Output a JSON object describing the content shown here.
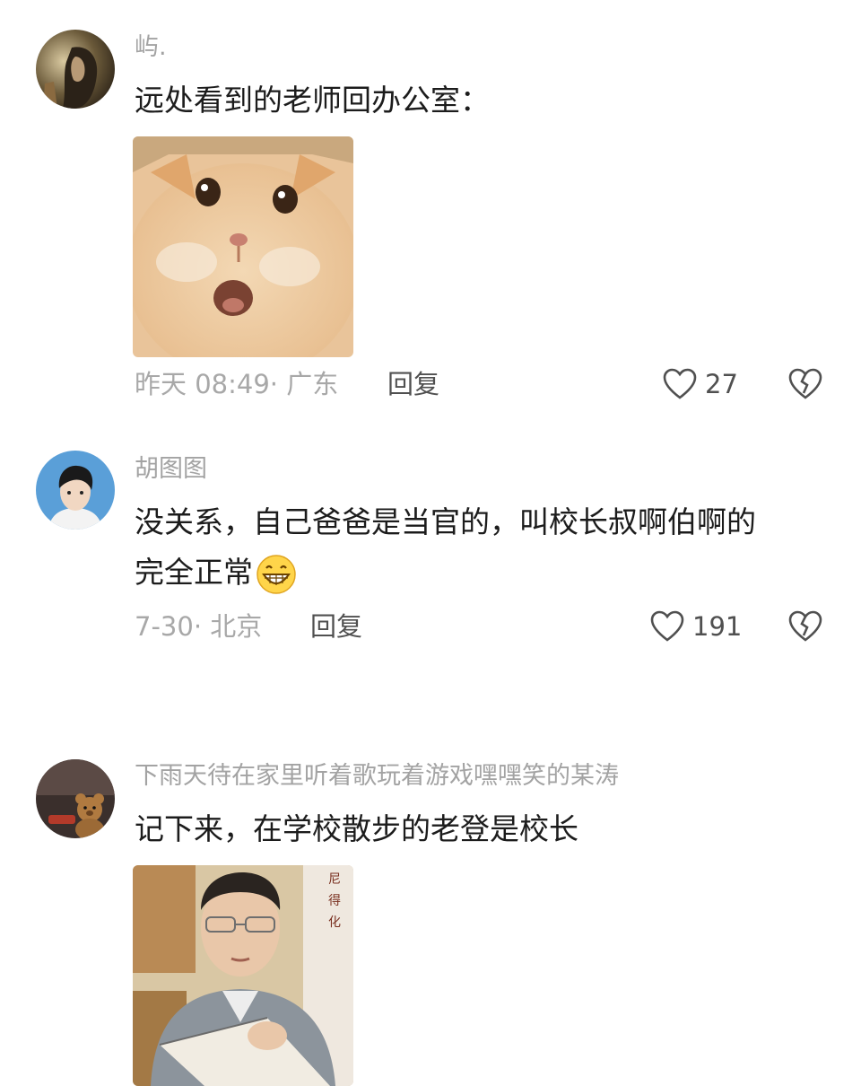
{
  "comments": [
    {
      "username": "屿.",
      "text": "远处看到的老师回办公室：",
      "time_location": "昨天 08:49· 广东",
      "reply_label": "回复",
      "likes": "27",
      "media_desc": "cat-shocked-image"
    },
    {
      "username": "胡图图",
      "text_line1": "没关系，自己爸爸是当官的，叫校长叔啊伯啊的",
      "text_line2": "完全正常",
      "time_location": "7-30· 北京",
      "reply_label": "回复",
      "likes": "191"
    },
    {
      "username": "下雨天待在家里听着歌玩着游戏嘿嘿笑的某涛",
      "text": "记下来，在学校散步的老登是校长",
      "media_desc": "man-reading-book-image"
    }
  ],
  "colors": {
    "text": "#1c1c1c",
    "meta": "#a8a8a8",
    "username": "#a3a3a3",
    "icon": "#505050"
  }
}
